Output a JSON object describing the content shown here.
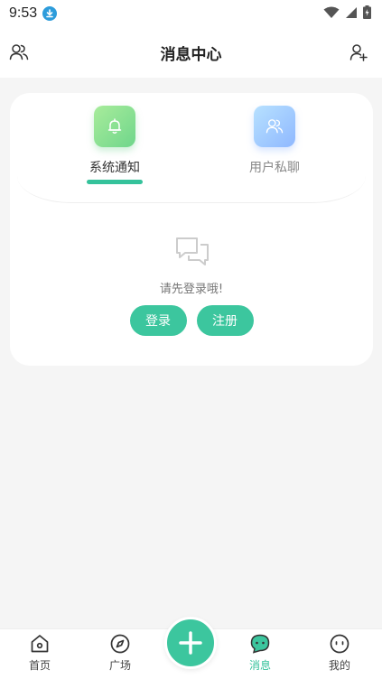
{
  "status_bar": {
    "time": "9:53",
    "icons": [
      "download-icon",
      "wifi-icon",
      "signal-icon",
      "battery-icon"
    ]
  },
  "header": {
    "title": "消息中心",
    "left_icon": "contacts-icon",
    "right_icon": "add-friend-icon"
  },
  "tabs": [
    {
      "label": "系统通知",
      "icon": "bell-icon",
      "active": true
    },
    {
      "label": "用户私聊",
      "icon": "users-icon",
      "active": false
    }
  ],
  "empty_state": {
    "icon": "chat-bubbles-icon",
    "message": "请先登录哦!",
    "login_label": "登录",
    "register_label": "注册"
  },
  "bottom_nav": {
    "items": [
      {
        "label": "首页",
        "icon": "home-icon",
        "active": false
      },
      {
        "label": "广场",
        "icon": "compass-icon",
        "active": false
      },
      {
        "label": "消息",
        "icon": "message-icon",
        "active": true
      },
      {
        "label": "我的",
        "icon": "profile-icon",
        "active": false
      }
    ],
    "fab_icon": "plus-icon"
  },
  "colors": {
    "accent": "#3cc69e",
    "background": "#f5f5f5",
    "card": "#ffffff"
  }
}
